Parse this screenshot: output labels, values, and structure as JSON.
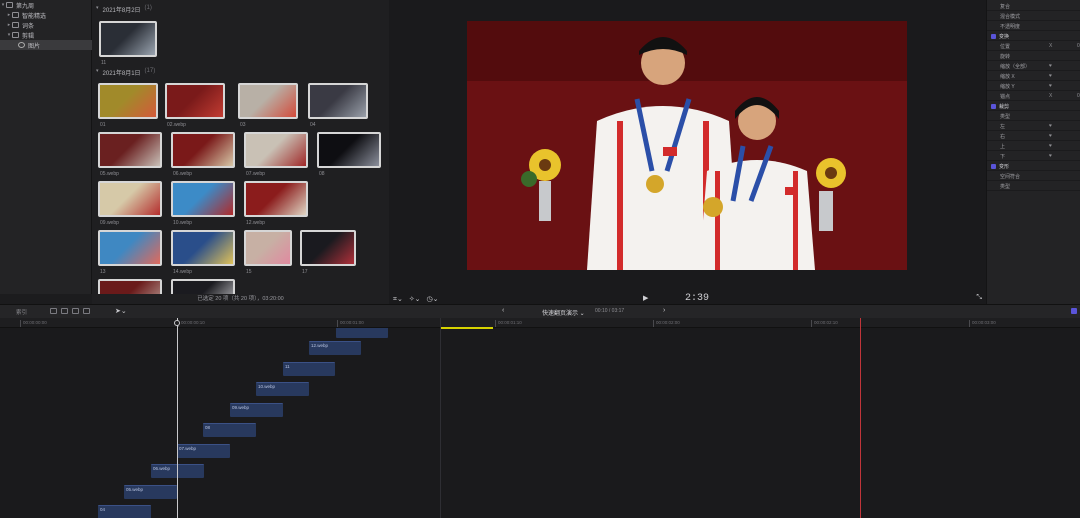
{
  "library": {
    "items": [
      {
        "label": "第九周",
        "indent": 0,
        "expanded": true,
        "icon": "library-icon",
        "selected": false
      },
      {
        "label": "智能精选",
        "indent": 1,
        "expanded": false,
        "icon": "folder-icon",
        "selected": false
      },
      {
        "label": "词条",
        "indent": 1,
        "expanded": false,
        "icon": "event-icon",
        "selected": false
      },
      {
        "label": "剪辑",
        "indent": 1,
        "expanded": true,
        "icon": "event-icon",
        "selected": false
      },
      {
        "label": "图片",
        "indent": 2,
        "expanded": false,
        "icon": "keyword-icon",
        "selected": true
      }
    ]
  },
  "browser": {
    "groups": [
      {
        "date": "2021年8月2日",
        "count": "(1)"
      },
      {
        "date": "2021年8月1日",
        "count": "(17)"
      }
    ],
    "clips": [
      {
        "label": "11",
        "colors": [
          "#2a2e36",
          "#9aa4b0"
        ]
      },
      {
        "label": "01",
        "colors": [
          "#a18a2a",
          "#d45a3a"
        ]
      },
      {
        "label": "02.webp",
        "colors": [
          "#7a1a1a",
          "#c23c32"
        ]
      },
      {
        "label": "03",
        "colors": [
          "#b8b0a6",
          "#d34b3b"
        ]
      },
      {
        "label": "04",
        "colors": [
          "#3a3a44",
          "#9aa0aa"
        ]
      },
      {
        "label": "05.webp",
        "colors": [
          "#6a2020",
          "#c9c0b8"
        ]
      },
      {
        "label": "06.webp",
        "colors": [
          "#7a1919",
          "#d8c8a8"
        ]
      },
      {
        "label": "07.webp",
        "colors": [
          "#c9c1b5",
          "#a02828"
        ]
      },
      {
        "label": "08",
        "colors": [
          "#0e0e12",
          "#8b8f9c"
        ]
      },
      {
        "label": "09.webp",
        "colors": [
          "#d6c9a8",
          "#b42d2d"
        ]
      },
      {
        "label": "10.webp",
        "colors": [
          "#3c8bc7",
          "#b02a2a"
        ]
      },
      {
        "label": "12.webp",
        "colors": [
          "#8b1c1c",
          "#e0d6c4"
        ]
      },
      {
        "label": "13",
        "colors": [
          "#3f88c2",
          "#e06a5c"
        ]
      },
      {
        "label": "14.webp",
        "colors": [
          "#2a4e8a",
          "#e0c25a"
        ]
      },
      {
        "label": "15",
        "colors": [
          "#c7b0a4",
          "#e08aa0"
        ]
      },
      {
        "label": "17",
        "colors": [
          "#1a1a1f",
          "#b0303a"
        ]
      },
      {
        "label": "",
        "colors": [
          "#6a1a1a",
          "#c0a8a0"
        ]
      },
      {
        "label": "",
        "colors": [
          "#1b1b20",
          "#d4d4d8"
        ]
      }
    ],
    "status": "已选定 20 项（共 20 项），03:20:00"
  },
  "viewer": {
    "timecode": "2:39",
    "colors": {
      "background": "#6a1113",
      "jacket": "#f4f2ef",
      "stripe": "#d22b2b",
      "medal": "#d4a62a",
      "flowers": "#e9c32c"
    }
  },
  "inspector": {
    "rows": [
      {
        "label": "复合",
        "section": false,
        "v1": "",
        "v2": ""
      },
      {
        "label": "混合模式",
        "section": false,
        "v1": "",
        "v2": ""
      },
      {
        "label": "不透明度",
        "section": false,
        "v1": "",
        "v2": ""
      },
      {
        "label": "变换",
        "section": true,
        "v1": "",
        "v2": ""
      },
      {
        "label": "位置",
        "section": false,
        "v1": "X",
        "v2": "0"
      },
      {
        "label": "旋转",
        "section": false,
        "v1": "",
        "v2": ""
      },
      {
        "label": "缩放（全部）",
        "section": false,
        "v1": "♥",
        "v2": ""
      },
      {
        "label": "缩放 X",
        "section": false,
        "v1": "♥",
        "v2": ""
      },
      {
        "label": "缩放 Y",
        "section": false,
        "v1": "♥",
        "v2": ""
      },
      {
        "label": "锚点",
        "section": false,
        "v1": "X",
        "v2": "0"
      },
      {
        "label": "裁剪",
        "section": true,
        "v1": "",
        "v2": ""
      },
      {
        "label": "类型",
        "section": false,
        "v1": "",
        "v2": ""
      },
      {
        "label": "左",
        "section": false,
        "v1": "♥",
        "v2": ""
      },
      {
        "label": "右",
        "section": false,
        "v1": "♥",
        "v2": ""
      },
      {
        "label": "上",
        "section": false,
        "v1": "♥",
        "v2": ""
      },
      {
        "label": "下",
        "section": false,
        "v1": "♥",
        "v2": ""
      },
      {
        "label": "变形",
        "section": true,
        "v1": "",
        "v2": ""
      },
      {
        "label": "空间符合",
        "section": false,
        "v1": "",
        "v2": ""
      },
      {
        "label": "类型",
        "section": false,
        "v1": "",
        "v2": ""
      }
    ]
  },
  "timeline": {
    "index_label": "索引",
    "project_title": "快速翻页演示 ⌄",
    "project_time": "00:10 / 03:17",
    "ticks": [
      "00:00:00:00",
      "00:00:00:10",
      "00:00:01:00",
      "00:00:01:10",
      "00:00:02:00",
      "00:00:02:10",
      "00:00:03:00"
    ],
    "clips": [
      {
        "label": ""
      },
      {
        "label": "12.webp"
      },
      {
        "label": "11"
      },
      {
        "label": "10.webp"
      },
      {
        "label": "09.webp"
      },
      {
        "label": "08"
      },
      {
        "label": "07.webp"
      },
      {
        "label": "06.webp"
      },
      {
        "label": "05.webp"
      },
      {
        "label": "04"
      }
    ]
  }
}
